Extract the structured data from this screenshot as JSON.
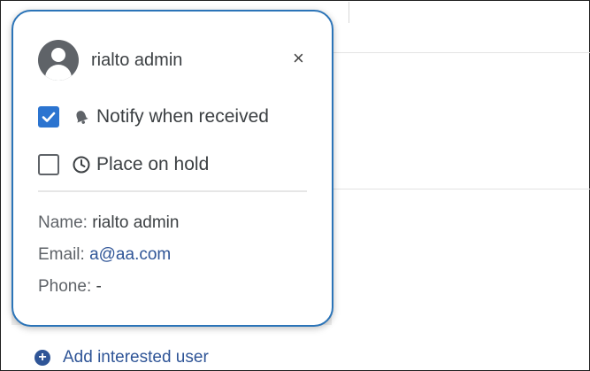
{
  "popover": {
    "user_name": "rialto admin",
    "options": [
      {
        "label": "Notify when received",
        "checked": true,
        "icon": "bell-icon"
      },
      {
        "label": "Place on hold",
        "checked": false,
        "icon": "clock-icon"
      }
    ],
    "details": {
      "name_label": "Name:",
      "name_value": "rialto admin",
      "email_label": "Email:",
      "email_value": "a@aa.com",
      "phone_label": "Phone:",
      "phone_value": "-"
    },
    "close_glyph": "×"
  },
  "add_user": {
    "label": "Add interested user",
    "icon": "plus-circle-icon",
    "glyph": "+"
  },
  "colors": {
    "accent": "#2b74d0",
    "border": "#2b74b8",
    "link": "#2f5597"
  }
}
